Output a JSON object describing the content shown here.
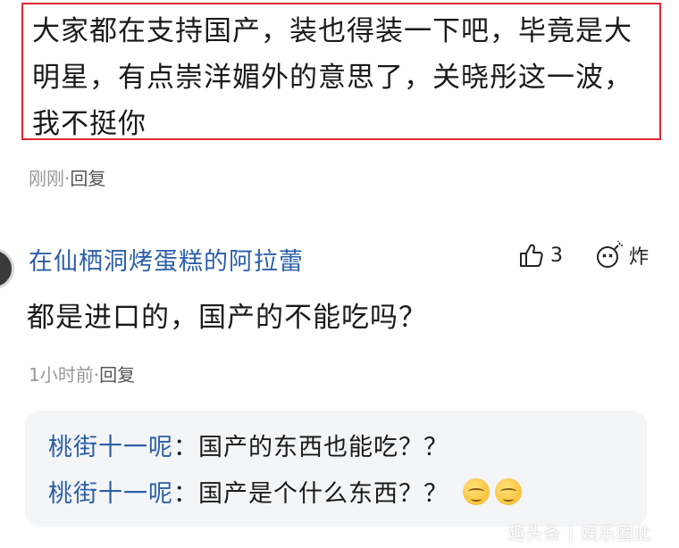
{
  "top_comment": {
    "text": "大家都在支持国产，装也得装一下吧，毕竟是大明星，有点崇洋媚外的意思了，关晓彤这一波，我不挺你",
    "time": "刚刚",
    "separator": "·",
    "reply_label": "回复"
  },
  "comment": {
    "username": "在仙栖洞烤蛋糕的阿拉蕾",
    "like_count": "3",
    "bomb_label": "炸",
    "text": "都是进口的，国产的不能吃吗？",
    "time": "1小时前",
    "separator": "·",
    "reply_label": "回复"
  },
  "replies": [
    {
      "user": "桃街十一呢",
      "colon": "：",
      "text": "国产的东西也能吃？？",
      "emoji_count": 0
    },
    {
      "user": "桃街十一呢",
      "colon": "：",
      "text": "国产是个什么东西？？",
      "emoji_count": 2
    }
  ],
  "icons": {
    "like": "thumbs-up-icon",
    "bomb": "bomb-icon",
    "emoji": "sleepy-face-emoji"
  },
  "watermark": "趣头条 | 娱乐圈此",
  "colors": {
    "highlight_border": "#e0282e",
    "username_blue": "#2b5fa8",
    "meta_gray": "#999999",
    "reply_bg": "#f4f5f7"
  }
}
